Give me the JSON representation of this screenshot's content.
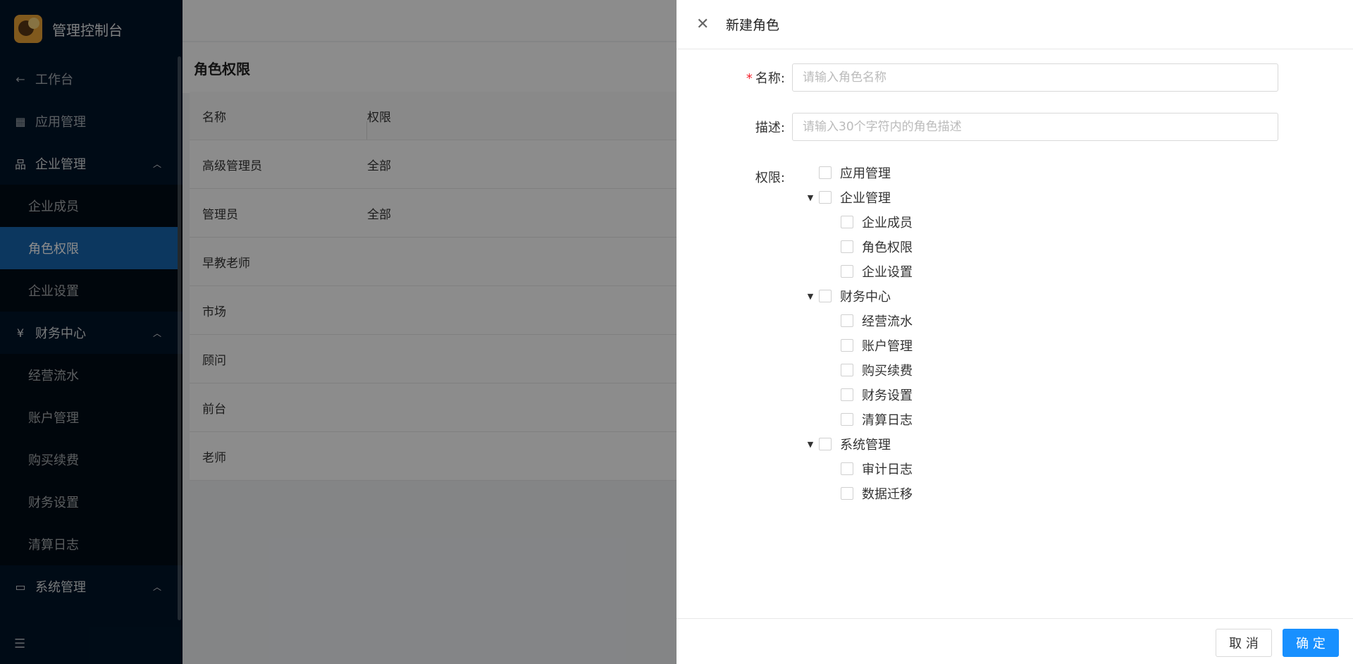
{
  "app": {
    "title": "管理控制台"
  },
  "sidebar": {
    "back": {
      "label": "工作台",
      "icon": "arrow-left-icon"
    },
    "items": [
      {
        "label": "应用管理",
        "icon": "apps-icon"
      },
      {
        "label": "企业管理",
        "icon": "org-icon",
        "expanded": true,
        "children": [
          "企业成员",
          "角色权限",
          "企业设置"
        ]
      },
      {
        "label": "财务中心",
        "icon": "yen-icon",
        "expanded": true,
        "children": [
          "经营流水",
          "账户管理",
          "购买续费",
          "财务设置",
          "清算日志"
        ]
      },
      {
        "label": "系统管理",
        "icon": "monitor-icon",
        "expanded": true
      }
    ],
    "active_item": "角色权限"
  },
  "page": {
    "title": "角色权限",
    "table": {
      "columns": [
        "名称",
        "权限"
      ],
      "rows": [
        [
          "高级管理员",
          "全部"
        ],
        [
          "管理员",
          "全部"
        ],
        [
          "早教老师",
          ""
        ],
        [
          "市场",
          ""
        ],
        [
          "顾问",
          ""
        ],
        [
          "前台",
          ""
        ],
        [
          "老师",
          ""
        ]
      ]
    }
  },
  "drawer": {
    "title": "新建角色",
    "name_label": "名称:",
    "name_placeholder": "请输入角色名称",
    "desc_label": "描述:",
    "desc_placeholder": "请输入30个字符内的角色描述",
    "perm_label": "权限:",
    "tree": [
      {
        "label": "应用管理",
        "checked": false
      },
      {
        "label": "企业管理",
        "checked": false,
        "expanded": true,
        "children": [
          {
            "label": "企业成员",
            "checked": false
          },
          {
            "label": "角色权限",
            "checked": false
          },
          {
            "label": "企业设置",
            "checked": false
          }
        ]
      },
      {
        "label": "财务中心",
        "checked": false,
        "expanded": true,
        "children": [
          {
            "label": "经营流水",
            "checked": false
          },
          {
            "label": "账户管理",
            "checked": false
          },
          {
            "label": "购买续费",
            "checked": false
          },
          {
            "label": "财务设置",
            "checked": false
          },
          {
            "label": "清算日志",
            "checked": false
          }
        ]
      },
      {
        "label": "系统管理",
        "checked": false,
        "expanded": true,
        "children": [
          {
            "label": "审计日志",
            "checked": false
          },
          {
            "label": "数据迁移",
            "checked": false
          }
        ]
      }
    ],
    "cancel_label": "取 消",
    "ok_label": "确 定",
    "accent_color": "#1890ff"
  }
}
